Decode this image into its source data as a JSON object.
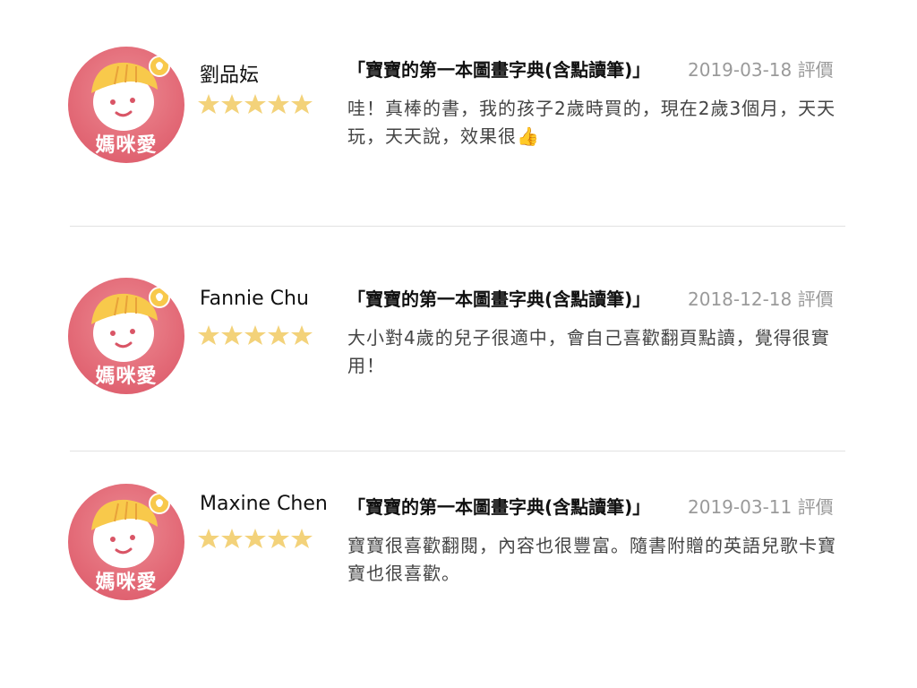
{
  "reviews": [
    {
      "avatar_label": "媽咪愛",
      "name": "劉品妘",
      "rating": 5,
      "product": "「寶寶的第一本圖畫字典(含點讀筆)」",
      "date": "2019-03-18 評價",
      "text": "哇！真棒的書，我的孩子2歲時買的，現在2歲3個月，天天玩，天天說，效果很👍"
    },
    {
      "avatar_label": "媽咪愛",
      "name": "Fannie Chu",
      "rating": 5,
      "product": "「寶寶的第一本圖畫字典(含點讀筆)」",
      "date": "2018-12-18 評價",
      "text": "大小對4歲的兒子很適中，會自己喜歡翻頁點讀，覺得很實用！"
    },
    {
      "avatar_label": "媽咪愛",
      "name": "Maxine Chen",
      "rating": 5,
      "product": "「寶寶的第一本圖畫字典(含點讀筆)」",
      "date": "2019-03-11 評價",
      "text": "寶寶很喜歡翻閱，內容也很豐富。隨書附贈的英語兒歌卡寶寶也很喜歡。"
    }
  ],
  "colors": {
    "star": "#f3d27a",
    "avatar_bg": "#e36a77",
    "hat": "#f8c94b",
    "date_text": "#9a9a9a"
  },
  "icons": {
    "avatar": "baby-face-icon",
    "badge": "lightbulb-badge-icon",
    "star": "star-icon"
  }
}
